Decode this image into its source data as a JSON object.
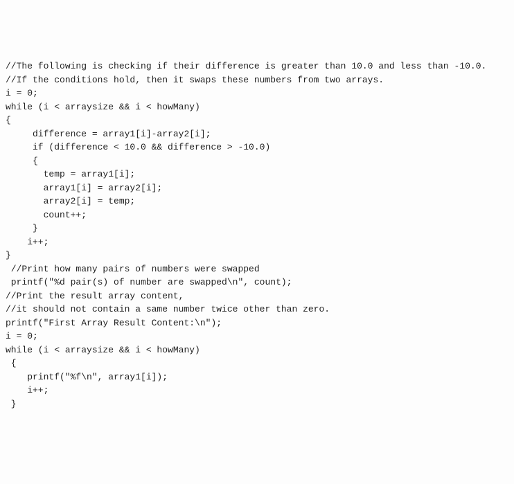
{
  "code": {
    "lines": [
      "//The following is checking if their difference is greater than 10.0 and less than -10.0.",
      "//If the conditions hold, then it swaps these numbers from two arrays.",
      "i = 0;",
      "while (i < arraysize && i < howMany)",
      "{",
      "     difference = array1[i]-array2[i];",
      "     if (difference < 10.0 && difference > -10.0)",
      "     {",
      "       temp = array1[i];",
      "       array1[i] = array2[i];",
      "       array2[i] = temp;",
      "       count++;",
      "     }",
      "    i++;",
      "}",
      "",
      " //Print how many pairs of numbers were swapped",
      " printf(\"%d pair(s) of number are swapped\\n\", count);",
      "",
      "//Print the result array content,",
      "//it should not contain a same number twice other than zero.",
      "printf(\"First Array Result Content:\\n\");",
      "i = 0;",
      "while (i < arraysize && i < howMany)",
      " {",
      "    printf(\"%f\\n\", array1[i]);",
      "    i++;",
      " }"
    ]
  }
}
